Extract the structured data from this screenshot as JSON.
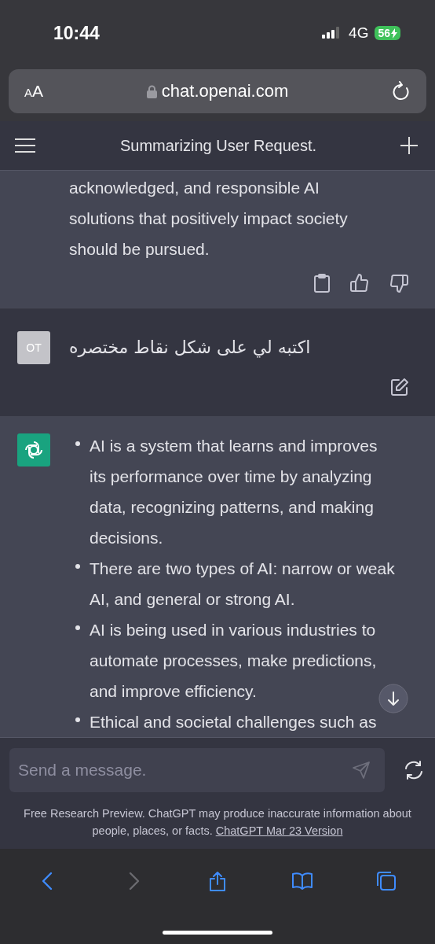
{
  "status_bar": {
    "time": "10:44",
    "network": "4G",
    "battery": "56",
    "charging": true
  },
  "address_bar": {
    "text_size_button": "AA",
    "url": "chat.openai.com",
    "secure": true
  },
  "header": {
    "title": "Summarizing User Request."
  },
  "messages": [
    {
      "kind": "assistant",
      "text": "acknowledged, and responsible AI solutions that positively impact society should be pursued."
    },
    {
      "kind": "user",
      "avatar": "OT",
      "text": "اكتبه لي على شكل نقاط مختصره"
    },
    {
      "kind": "assistant",
      "bullets": [
        "AI is a system that learns and improves its performance over time by analyzing data, recognizing patterns, and making decisions.",
        "There are two types of AI: narrow or weak AI, and general or strong AI.",
        "AI is being used in various industries to automate processes, make predictions, and improve efficiency.",
        "Ethical and societal challenges such as"
      ]
    }
  ],
  "composer": {
    "placeholder": "Send a message."
  },
  "disclaimer": {
    "text": "Free Research Preview. ChatGPT may produce inaccurate information about people, places, or facts.",
    "link": "ChatGPT Mar 23 Version"
  },
  "toolbar": [
    {
      "kind": "back",
      "disabled": false
    },
    {
      "kind": "forward",
      "disabled": true
    },
    {
      "kind": "share",
      "disabled": false
    },
    {
      "kind": "bookmarks",
      "disabled": false
    },
    {
      "kind": "tabs",
      "disabled": false
    }
  ]
}
